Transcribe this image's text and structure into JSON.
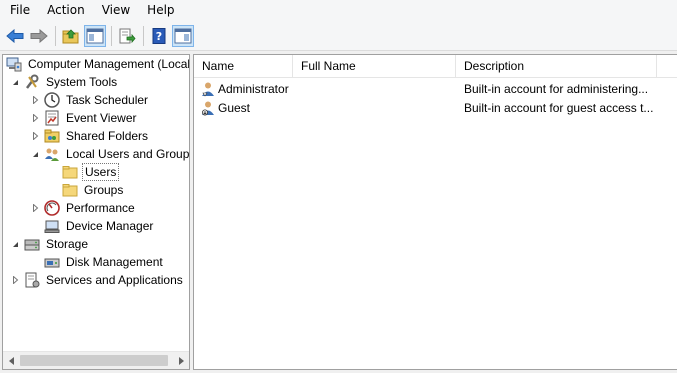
{
  "menu": [
    "File",
    "Action",
    "View",
    "Help"
  ],
  "toolbar": {
    "buttons": [
      "back-arrow-icon",
      "forward-arrow-icon",
      "up-folder-icon",
      "show-hide-console-tree-icon",
      "export-list-icon",
      "help-icon",
      "show-hide-action-pane-icon"
    ]
  },
  "tree": {
    "root": "Computer Management (Local",
    "system_tools": "System Tools",
    "task_scheduler": "Task Scheduler",
    "event_viewer": "Event Viewer",
    "shared_folders": "Shared Folders",
    "local_users_groups": "Local Users and Groups",
    "users": "Users",
    "groups": "Groups",
    "performance": "Performance",
    "device_manager": "Device Manager",
    "storage": "Storage",
    "disk_management": "Disk Management",
    "services_apps": "Services and Applications"
  },
  "list": {
    "columns": [
      "Name",
      "Full Name",
      "Description"
    ],
    "rows": [
      {
        "name": "Administrator",
        "full_name": "",
        "description": "Built-in account for administering..."
      },
      {
        "name": "Guest",
        "full_name": "",
        "description": "Built-in account for guest access t..."
      }
    ]
  },
  "colors": {
    "selection_border": "#7eb4ea",
    "folder_yellow": "#f5d77a"
  }
}
